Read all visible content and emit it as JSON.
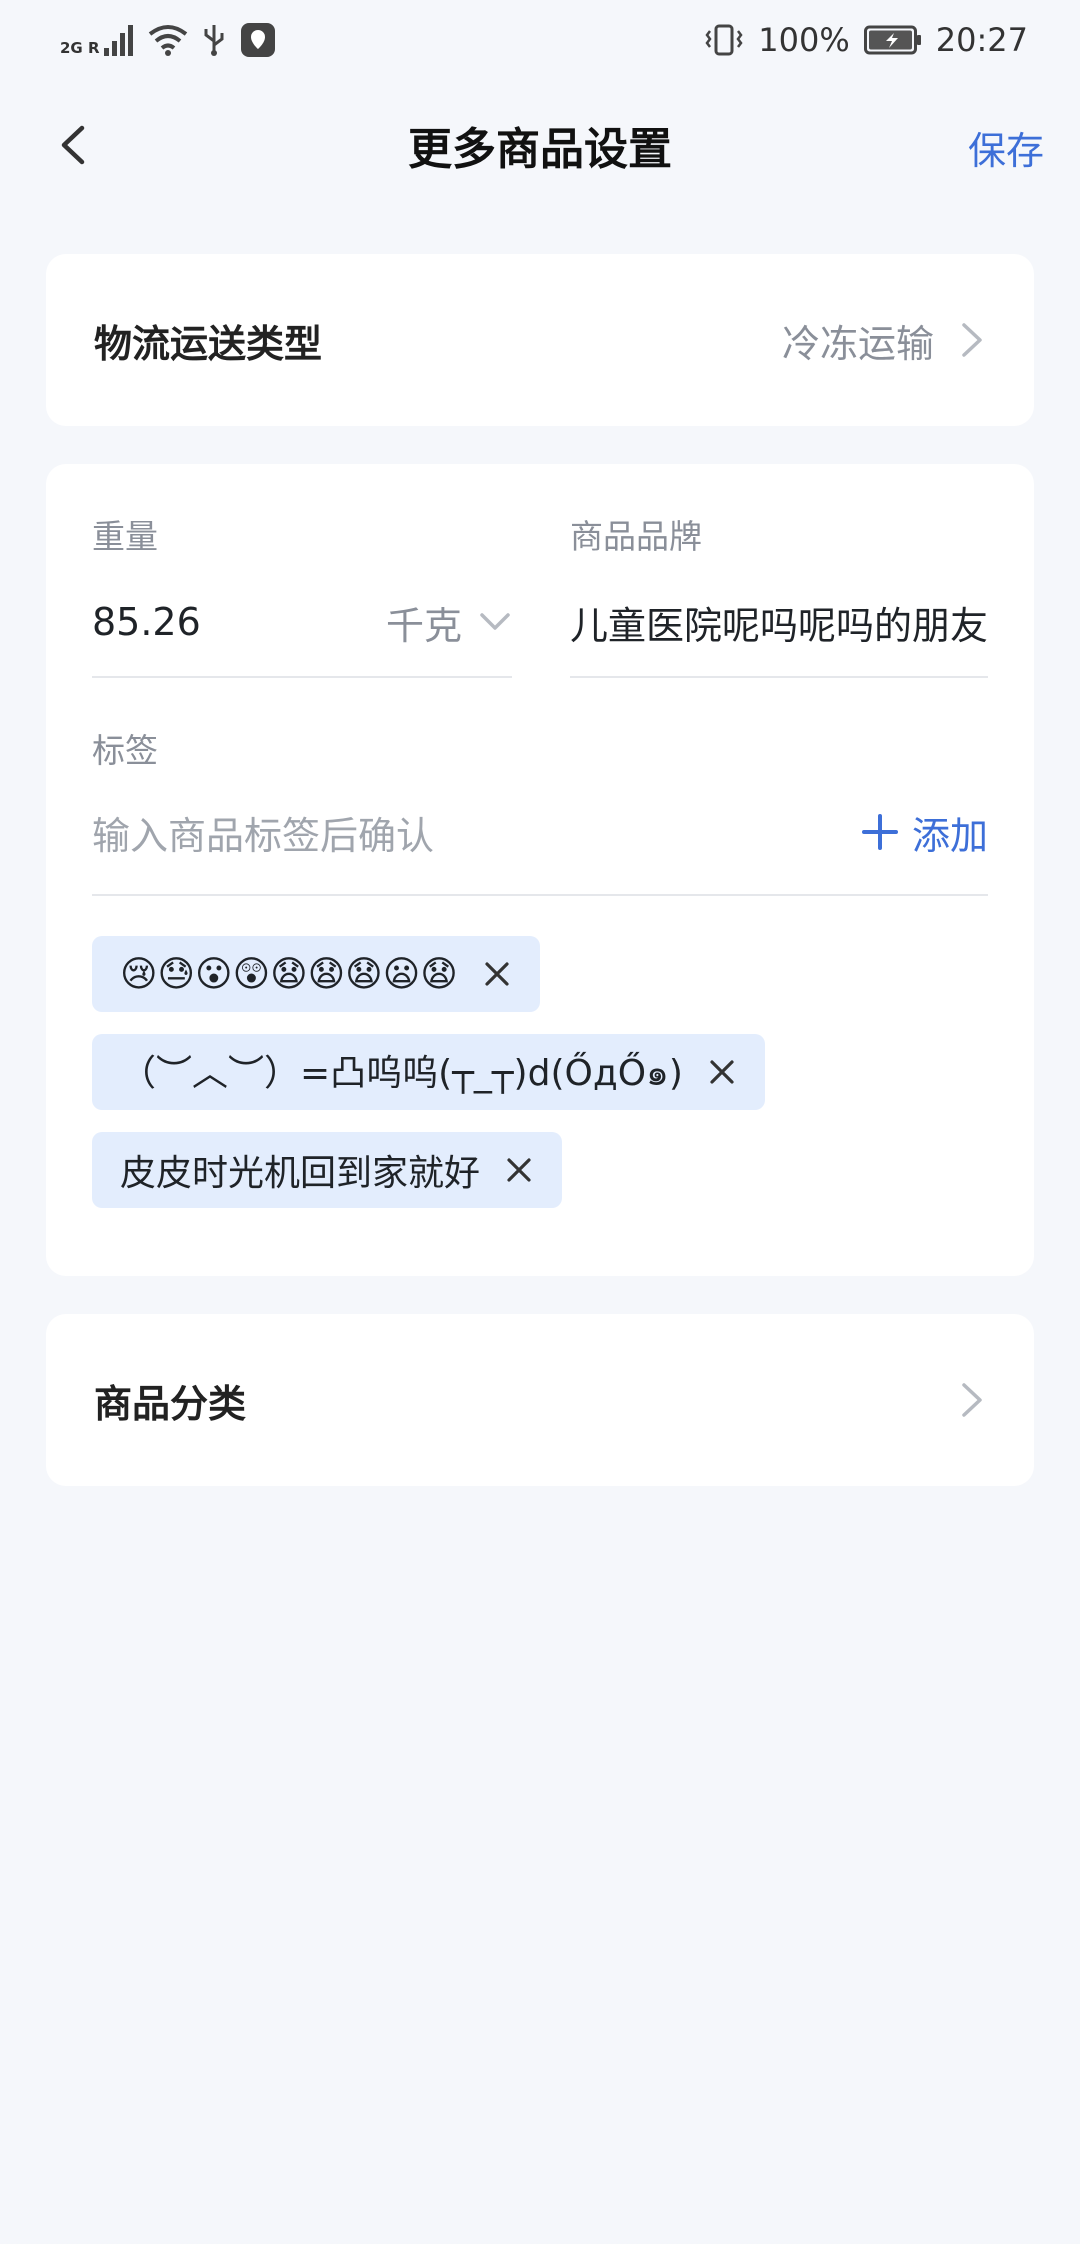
{
  "status_bar": {
    "network": "2G R",
    "battery": "100%",
    "time": "20:27"
  },
  "nav": {
    "title": "更多商品设置",
    "save_label": "保存"
  },
  "logistics": {
    "label": "物流运送类型",
    "value": "冷冻运输"
  },
  "weight": {
    "label": "重量",
    "value": "85.26",
    "unit": "千克"
  },
  "brand": {
    "label": "商品品牌",
    "value": "儿童医院呢吗呢吗的朋友"
  },
  "tags": {
    "label": "标签",
    "placeholder": "输入商品标签后确认",
    "add_label": "添加",
    "items": [
      "😢😓😮😲😧😧😧😦😧",
      "（︶︿︶）=凸呜呜(┬_┬)d(ŐдŐ๑)",
      "皮皮时光机回到家就好"
    ]
  },
  "category": {
    "label": "商品分类"
  },
  "colors": {
    "accent": "#3d6fd8",
    "tag_bg": "#e3edfd",
    "page_bg": "#f5f7fb"
  }
}
